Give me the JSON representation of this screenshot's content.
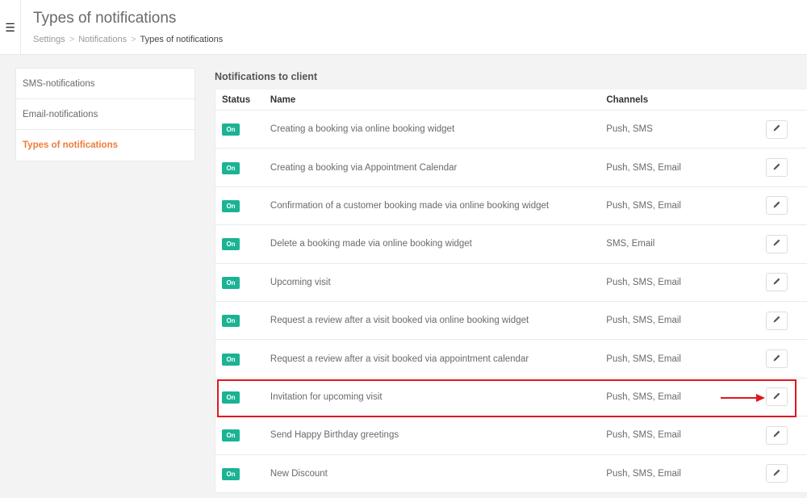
{
  "header": {
    "title": "Types of notifications",
    "menu_icon": "☰",
    "breadcrumb": [
      "Settings",
      "Notifications",
      "Types of notifications"
    ],
    "breadcrumb_sep": ">"
  },
  "sidebar": {
    "items": [
      {
        "label": "SMS-notifications",
        "active": false
      },
      {
        "label": "Email-notifications",
        "active": false
      },
      {
        "label": "Types of notifications",
        "active": true
      }
    ]
  },
  "main": {
    "section_title": "Notifications to client",
    "columns": [
      "Status",
      "Name",
      "Channels"
    ],
    "rows": [
      {
        "status": "On",
        "name": "Creating a booking via online booking widget",
        "channels": "Push, SMS"
      },
      {
        "status": "On",
        "name": "Creating a booking via Appointment Calendar",
        "channels": "Push, SMS, Email"
      },
      {
        "status": "On",
        "name": "Confirmation of a customer booking made via online booking widget",
        "channels": "Push, SMS, Email"
      },
      {
        "status": "On",
        "name": "Delete a booking made via online booking widget",
        "channels": "SMS, Email"
      },
      {
        "status": "On",
        "name": "Upcoming visit",
        "channels": "Push, SMS, Email"
      },
      {
        "status": "On",
        "name": "Request a review after a visit booked via online booking widget",
        "channels": "Push, SMS, Email"
      },
      {
        "status": "On",
        "name": "Request a review after a visit booked via appointment calendar",
        "channels": "Push, SMS, Email"
      },
      {
        "status": "On",
        "name": "Invitation for upcoming visit",
        "channels": "Push, SMS, Email"
      },
      {
        "status": "On",
        "name": "Send Happy Birthday greetings",
        "channels": "Push, SMS, Email"
      },
      {
        "status": "On",
        "name": "New Discount",
        "channels": "Push, SMS, Email"
      }
    ]
  },
  "colors": {
    "status_on": "#1ab394",
    "active_sidebar": "#f07b38",
    "highlight": "#e0181f"
  }
}
